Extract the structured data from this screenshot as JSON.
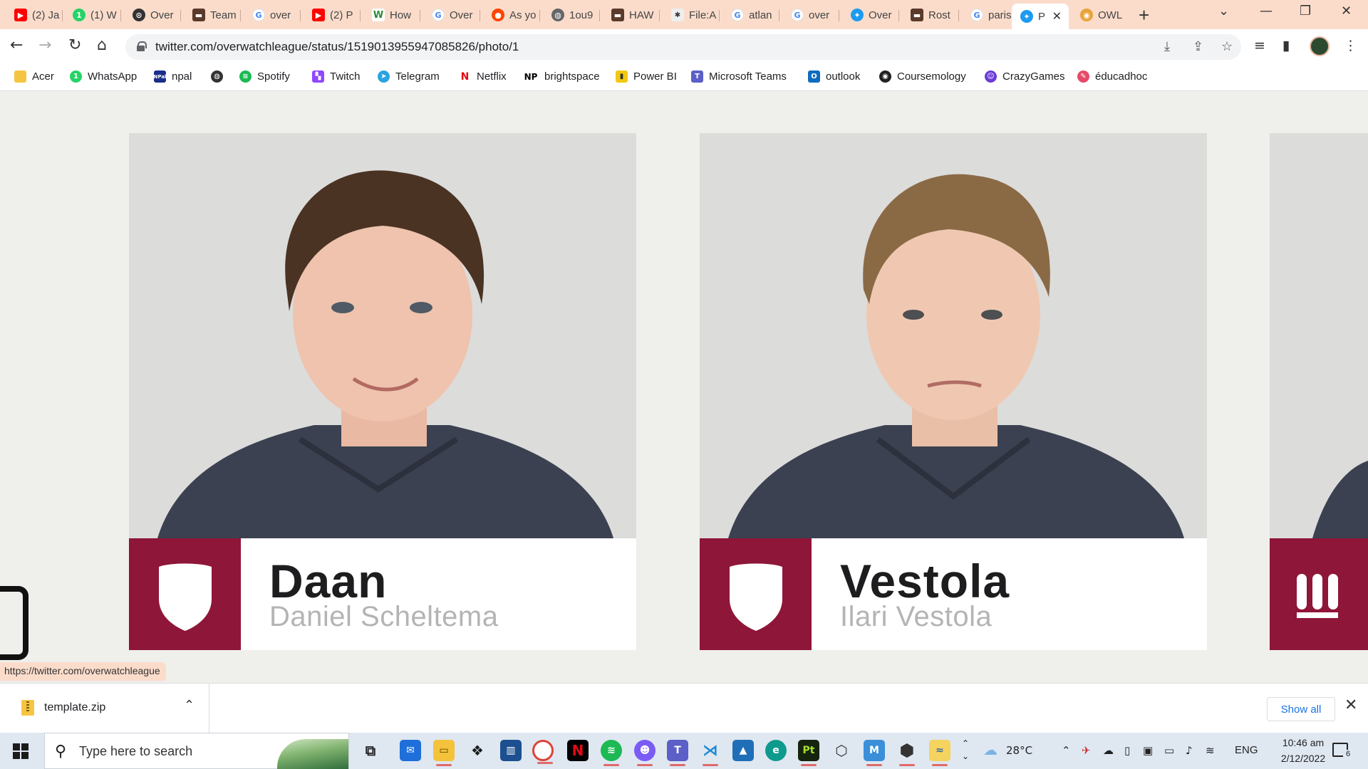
{
  "tabs": [
    {
      "label": "(2) Ja",
      "icon": "youtube-icon"
    },
    {
      "label": "(1) W",
      "icon": "whatsapp-icon"
    },
    {
      "label": "Over",
      "icon": "overwatch-icon"
    },
    {
      "label": "Team",
      "icon": "liquipedia-icon"
    },
    {
      "label": "over",
      "icon": "google-icon"
    },
    {
      "label": "(2) P",
      "icon": "youtube-icon"
    },
    {
      "label": "How",
      "icon": "wikihow-icon"
    },
    {
      "label": "Over",
      "icon": "google-icon"
    },
    {
      "label": "As yo",
      "icon": "reddit-icon"
    },
    {
      "label": "1ou9",
      "icon": "globe-icon"
    },
    {
      "label": "HAW",
      "icon": "liquipedia-icon"
    },
    {
      "label": "File:A",
      "icon": "wiki-icon"
    },
    {
      "label": "atlan",
      "icon": "google-icon"
    },
    {
      "label": "over",
      "icon": "google-icon"
    },
    {
      "label": "Over",
      "icon": "twitter-icon"
    },
    {
      "label": "Rost",
      "icon": "liquipedia-icon"
    },
    {
      "label": "paris",
      "icon": "google-icon"
    },
    {
      "label": "P",
      "icon": "twitter-icon",
      "active": true
    },
    {
      "label": "OWL",
      "icon": "owl-icon"
    }
  ],
  "toolbar": {
    "url": "twitter.com/overwatchleague/status/1519013955947085826/photo/1"
  },
  "bookmarks": [
    {
      "label": "Acer",
      "icon": "folder-icon"
    },
    {
      "label": "WhatsApp",
      "icon": "whatsapp-icon"
    },
    {
      "label": "npal",
      "icon": "npal-icon"
    },
    {
      "label": "",
      "icon": "globe-icon"
    },
    {
      "label": "Spotify",
      "icon": "spotify-icon"
    },
    {
      "label": "Twitch",
      "icon": "twitch-icon"
    },
    {
      "label": "Telegram",
      "icon": "telegram-icon"
    },
    {
      "label": "Netflix",
      "icon": "netflix-icon"
    },
    {
      "label": "brightspace",
      "icon": "np-icon"
    },
    {
      "label": "Power BI",
      "icon": "powerbi-icon"
    },
    {
      "label": "Microsoft Teams",
      "icon": "teams-icon"
    },
    {
      "label": "outlook",
      "icon": "outlook-icon"
    },
    {
      "label": "Coursemology",
      "icon": "coursemology-icon"
    },
    {
      "label": "CrazyGames",
      "icon": "crazygames-icon"
    },
    {
      "label": "éducadhoc",
      "icon": "educadhoc-icon"
    }
  ],
  "cards": [
    {
      "gamer_tag": "Daan",
      "real_name": "Daniel Scheltema"
    },
    {
      "gamer_tag": "Vestola",
      "real_name": "Ilari Vestola"
    }
  ],
  "status_bar": {
    "url": "https://twitter.com/overwatchleague"
  },
  "download": {
    "file_name": "template.zip",
    "show_all_label": "Show all"
  },
  "taskbar": {
    "search_placeholder": "Type here to search",
    "weather": "28°C",
    "language": "ENG",
    "time": "10:46 am",
    "date": "2/12/2022",
    "notification_count": "6"
  },
  "colors": {
    "team_maroon": "#8e1638",
    "tab_strip": "#fbdccb"
  }
}
